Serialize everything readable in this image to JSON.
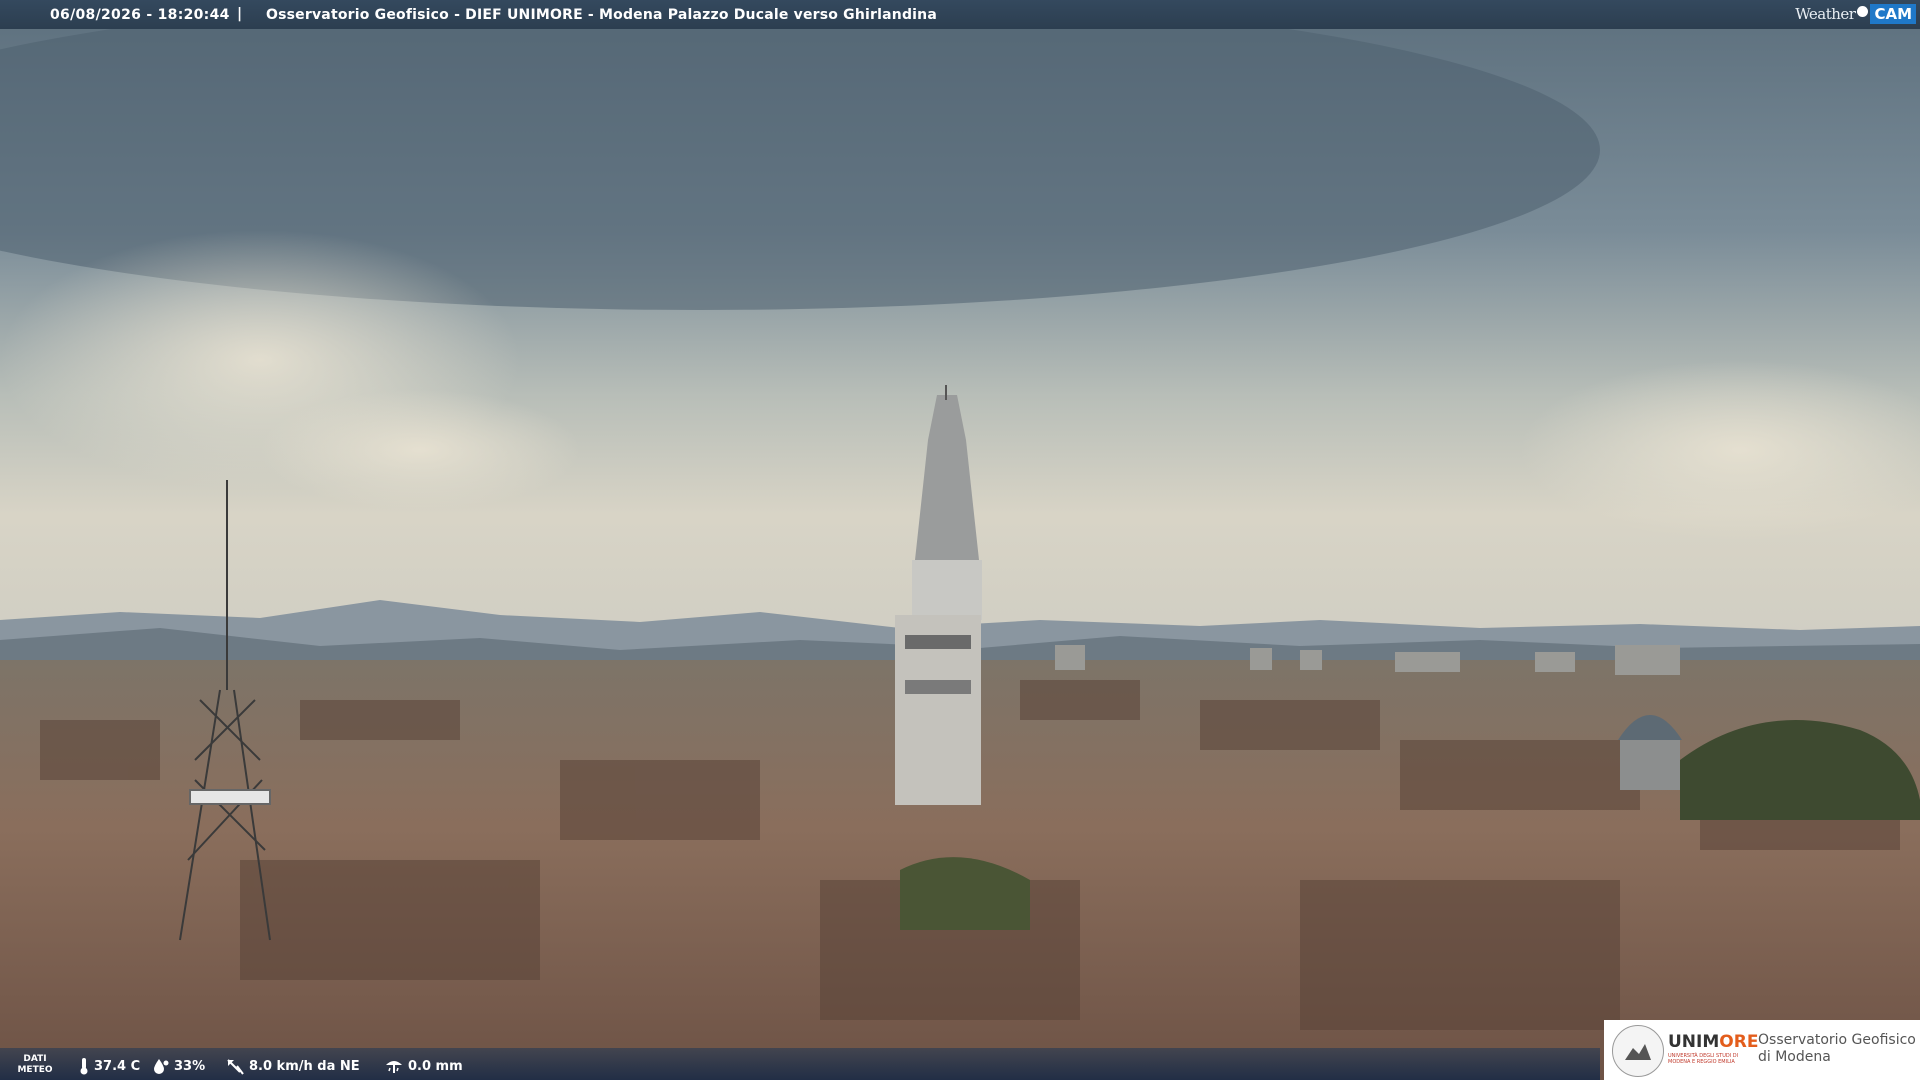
{
  "header": {
    "timestamp": "06/08/2026 - 18:20:44",
    "separator": "|",
    "title": "Osservatorio Geofisico - DIEF UNIMORE - Modena Palazzo Ducale verso Ghirlandina",
    "logo": {
      "word": "Weather",
      "cam": "CAM"
    }
  },
  "weather": {
    "label_line1": "DATI",
    "label_line2": "METEO",
    "temperature": "37.4 C",
    "humidity": "33%",
    "wind": "8.0 km/h da NE",
    "rain": "0.0 mm",
    "icons": [
      "thermometer-icon",
      "humidity-drop-icon",
      "wind-vane-icon",
      "rain-gauge-icon"
    ]
  },
  "branding": {
    "name_part1": "UNIM",
    "name_part2": "ORE",
    "university_line": "UNIVERSITÀ DEGLI STUDI DI MODENA E REGGIO EMILIA",
    "observatory_line1": "Osservatorio Geofisico",
    "observatory_line2": "di Modena"
  },
  "colors": {
    "topbar": "#2c3e50",
    "accent": "#1f78c8",
    "brand_orange": "#e35d1c"
  }
}
